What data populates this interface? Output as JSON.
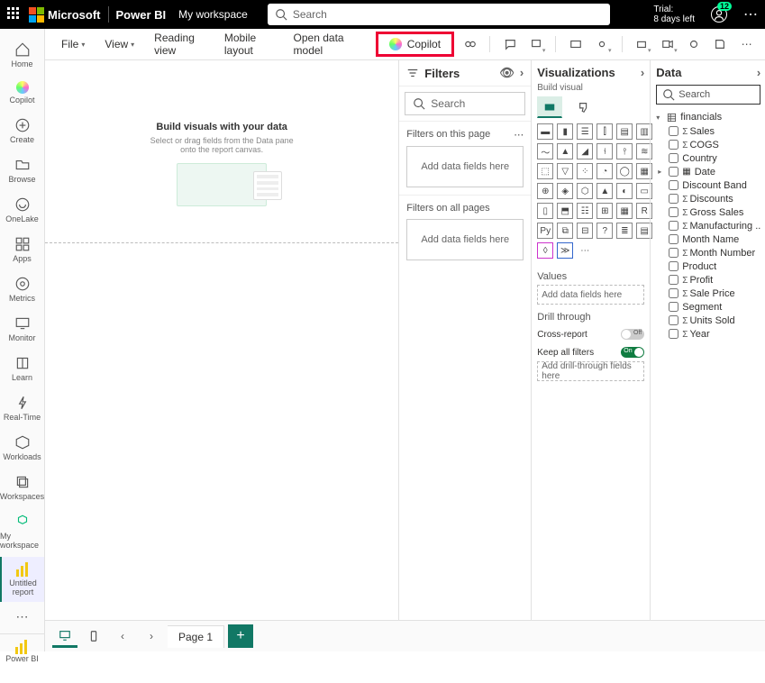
{
  "topbar": {
    "brand": "Microsoft",
    "product": "Power BI",
    "workspace": "My workspace",
    "search_placeholder": "Search",
    "trial_line1": "Trial:",
    "trial_line2": "8 days left",
    "notif_count": "12"
  },
  "rail": {
    "items": [
      {
        "label": "Home"
      },
      {
        "label": "Copilot"
      },
      {
        "label": "Create"
      },
      {
        "label": "Browse"
      },
      {
        "label": "OneLake"
      },
      {
        "label": "Apps"
      },
      {
        "label": "Metrics"
      },
      {
        "label": "Monitor"
      },
      {
        "label": "Learn"
      },
      {
        "label": "Real-Time"
      },
      {
        "label": "Workloads"
      },
      {
        "label": "Workspaces"
      },
      {
        "label": "My workspace"
      },
      {
        "label": "Untitled report"
      }
    ],
    "corner": "Power BI"
  },
  "ribbon": {
    "file": "File",
    "view": "View",
    "reading": "Reading view",
    "mobile": "Mobile layout",
    "opendata": "Open data model",
    "copilot": "Copilot"
  },
  "canvas": {
    "headline": "Build visuals with your data",
    "sub": "Select or drag fields from the Data pane onto the report canvas."
  },
  "filters": {
    "title": "Filters",
    "search_placeholder": "Search",
    "page_label": "Filters on this page",
    "all_label": "Filters on all pages",
    "drop_hint": "Add data fields here"
  },
  "viz": {
    "title": "Visualizations",
    "crumb": "Build visual",
    "values": "Values",
    "values_hint": "Add data fields here",
    "drill": "Drill through",
    "cross": "Cross-report",
    "keep": "Keep all filters",
    "drill_hint": "Add drill-through fields here",
    "off": "Off",
    "on": "On"
  },
  "dataP": {
    "title": "Data",
    "search_placeholder": "Search",
    "table": "financials",
    "fields": [
      {
        "name": "Sales",
        "sigma": true
      },
      {
        "name": "COGS",
        "sigma": true
      },
      {
        "name": "Country",
        "sigma": false
      },
      {
        "name": "Date",
        "sigma": false,
        "date": true
      },
      {
        "name": "Discount Band",
        "sigma": false
      },
      {
        "name": "Discounts",
        "sigma": true
      },
      {
        "name": "Gross Sales",
        "sigma": true
      },
      {
        "name": "Manufacturing ...",
        "sigma": true
      },
      {
        "name": "Month Name",
        "sigma": false
      },
      {
        "name": "Month Number",
        "sigma": true
      },
      {
        "name": "Product",
        "sigma": false
      },
      {
        "name": "Profit",
        "sigma": true
      },
      {
        "name": "Sale Price",
        "sigma": true
      },
      {
        "name": "Segment",
        "sigma": false
      },
      {
        "name": "Units Sold",
        "sigma": true
      },
      {
        "name": "Year",
        "sigma": true
      }
    ]
  },
  "pager": {
    "page1": "Page 1"
  }
}
